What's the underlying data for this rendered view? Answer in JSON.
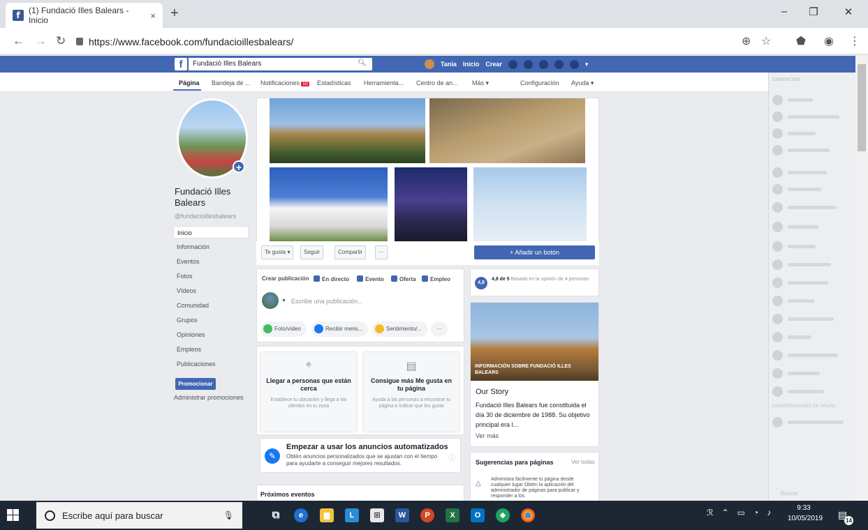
{
  "browser": {
    "tab_title": "(1) Fundació Illes Balears - Inicio",
    "tab_close": "×",
    "new_tab": "+",
    "url": "https://www.facebook.com/fundacioillesbalears/",
    "window_minimize": "–",
    "window_restore": "❐",
    "window_close": "✕"
  },
  "fb_header": {
    "search_value": "Fundació Illes Balears",
    "user_name": "Tania",
    "home_label": "Inicio",
    "create_label": "Crear"
  },
  "subnav": {
    "items": [
      "Página",
      "Bandeja de ...",
      "Notificaciones",
      "Estadísticas",
      "Herramienta...",
      "Centro de an...",
      "Más ▾",
      "Configuración",
      "Ayuda ▾"
    ],
    "notif_badge": "10"
  },
  "page": {
    "name": "Fundació Illes Balears",
    "handle": "@fundacioillesbalears",
    "nav": [
      "Inicio",
      "Información",
      "Eventos",
      "Fotos",
      "Vídeos",
      "Comunidad",
      "Grupos",
      "Opiniones",
      "Empleos",
      "Publicaciones"
    ],
    "promote_label": "Promocionar",
    "manage_promotions": "Administrar promociones"
  },
  "cover_actions": {
    "like": "Te gusta ▾",
    "follow": "Seguir",
    "share": "Compartir",
    "more": "···",
    "add_button": "+ Añadir un botón"
  },
  "composer": {
    "tabs": [
      "Crear publicación",
      "En directo",
      "Evento",
      "Oferta",
      "Empleo"
    ],
    "placeholder": "Escribe una publicación...",
    "buttons": [
      "Foto/vídeo",
      "Recibir mens...",
      "Sentimiento/...",
      "···"
    ]
  },
  "promo_cards": [
    {
      "title": "Llegar a personas que están cerca",
      "text": "Establece tu ubicación y llega a los clientes en tu zona"
    },
    {
      "title": "Consigue más Me gusta en tu página",
      "text": "Ayuda a las personas a encontrar tu página e indicar que les gusta"
    }
  ],
  "auto_ads": {
    "title": "Empezar a usar los anuncios automatizados",
    "text": "Obtén anuncios personalizados que se ajustan con el tiempo para ayudarte a conseguir mejores resultados."
  },
  "events": {
    "title": "Próximos eventos"
  },
  "rating": {
    "badge": "4,8",
    "score_text": "4,8 de 5",
    "detail": "Basada en la opinión de 4 personas"
  },
  "info": {
    "header": "INFORMACIÓN SOBRE FUNDACIÓ ILLES BALEARS",
    "story_title": "Our Story",
    "story_text": "Fundació Illes Balears fue constituida el día 30 de diciembre de 1988. Su objetivo principal era l...",
    "see_more": "Ver más"
  },
  "suggestions": {
    "title": "Sugerencias para páginas",
    "see_all": "Ver todas",
    "text": "Administra fácilmente tu página desde cualquier lugar Obtén la aplicación del administrador de páginas para publicar y responder a los"
  },
  "chat": {
    "contacts_header": "CONTACTOS",
    "section2": "CONVERSACIONES DE GRUPO",
    "search_placeholder": "Buscar"
  },
  "taskbar": {
    "search_placeholder": "Escribe aquí para buscar",
    "time": "9:33",
    "date": "10/05/2019",
    "notif_count": "14"
  },
  "colors": {
    "fb_blue": "#4267b2",
    "taskbar": "#1c2733",
    "page_bg": "#e9ebee"
  }
}
